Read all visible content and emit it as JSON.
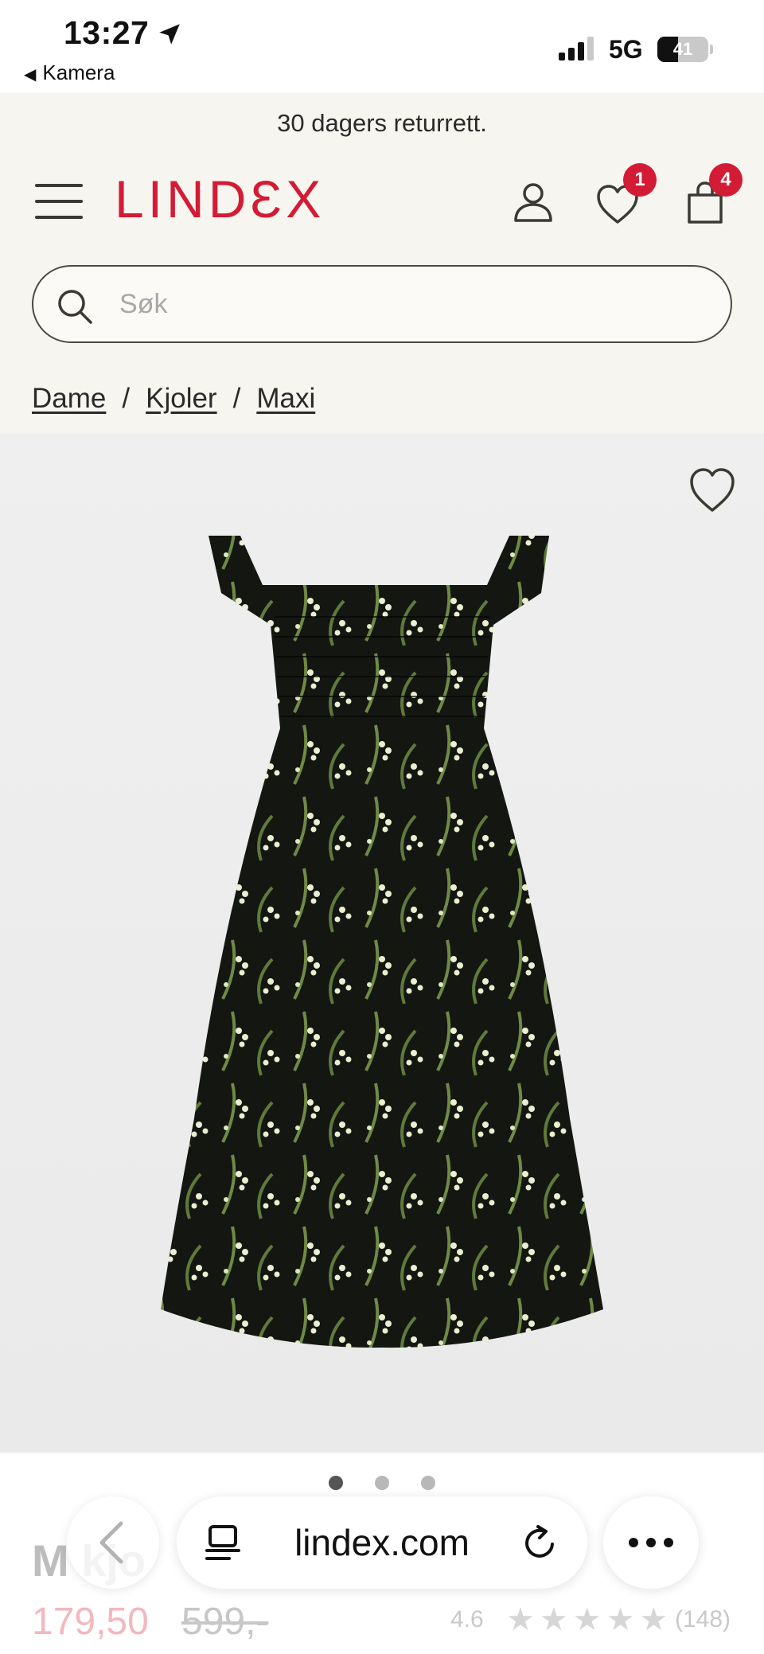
{
  "status_bar": {
    "time": "13:27",
    "back_app": "Kamera",
    "network": "5G",
    "battery": "41",
    "battery_fraction": 0.41
  },
  "header": {
    "promo": "30 dagers returrett.",
    "logo": "LINDƐX",
    "wishlist_badge": "1",
    "cart_badge": "4",
    "brand_color": "#d41b35"
  },
  "search": {
    "placeholder": "Søk",
    "value": ""
  },
  "breadcrumb": {
    "items": [
      "Dame",
      "Kjoler",
      "Maxi"
    ],
    "separator": "/"
  },
  "gallery": {
    "image_count": 3,
    "active_index": 0
  },
  "product": {
    "name_partial": "M    kjo",
    "price": "179,50",
    "old_price": "599,-",
    "rating": "4.6",
    "rating_value": 4.6,
    "stars": "★★★★★",
    "review_count": "(148)"
  },
  "browser": {
    "url": "lindex.com"
  }
}
